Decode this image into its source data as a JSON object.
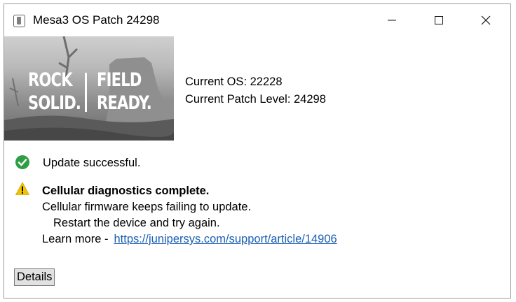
{
  "window": {
    "title": "Mesa3 OS Patch 24298"
  },
  "titlebar": {
    "icons": [
      "app-icon",
      "minimize-icon",
      "maximize-icon",
      "close-icon"
    ]
  },
  "banner": {
    "slogan_line1_left": "ROCK",
    "slogan_line1_right": "FIELD",
    "slogan_line2_left": "SOLID.",
    "slogan_line2_right": "READY."
  },
  "info": {
    "current_os": "Current OS: 22228",
    "current_patch": "Current Patch Level: 24298"
  },
  "status": {
    "success": {
      "icon": "check-circle-icon",
      "color": "#2e9e44",
      "text": "Update successful."
    },
    "warning": {
      "icon": "warning-triangle-icon",
      "color": "#f2c200",
      "title": "Cellular diagnostics complete.",
      "line1": "Cellular firmware keeps failing to update.",
      "line2": "Restart the device and try again.",
      "learn_more_label": "Learn more -",
      "link": "https://junipersys.com/support/article/14906"
    }
  },
  "buttons": {
    "details": "Details"
  }
}
